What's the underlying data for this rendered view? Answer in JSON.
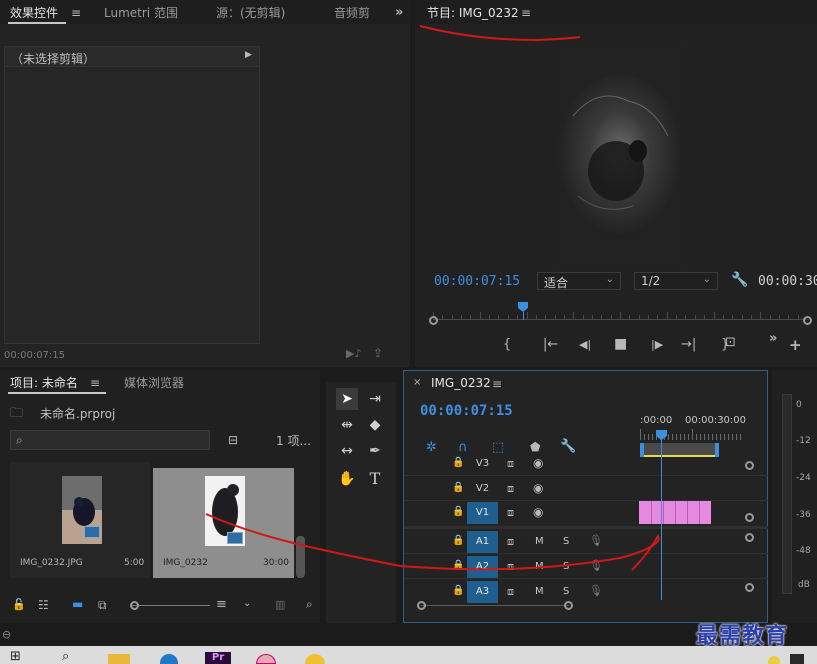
{
  "effect_controls": {
    "tabs": [
      "效果控件",
      "Lumetri 范围",
      "源：(无剪辑)",
      "音频剪"
    ],
    "no_clip": "（未选择剪辑）",
    "timecode": "00:00:07:15"
  },
  "program": {
    "tab_label": "节目: IMG_0232",
    "timecode": "00:00:07:15",
    "fit_option": "适合",
    "resolution": "1/2",
    "duration": "00:00:30",
    "playhead_fraction": 0.24
  },
  "project": {
    "tabs": [
      "项目: 未命名",
      "媒体浏览器"
    ],
    "project_file": "未命名.prproj",
    "item_count": "1 项...",
    "items": [
      {
        "name": "IMG_0232.JPG",
        "duration": "5:00"
      },
      {
        "name": "IMG_0232",
        "duration": "30:00"
      }
    ]
  },
  "timeline": {
    "tab_label": "IMG_0232",
    "timecode": "00:00:07:15",
    "ruler": [
      ":00:00",
      "00:00:30:00"
    ],
    "video_tracks": [
      "V3",
      "V2",
      "V1"
    ],
    "audio_tracks": [
      "A1",
      "A2",
      "A3"
    ],
    "mute_label": "M",
    "solo_label": "S"
  },
  "meters": {
    "scale": [
      "0",
      "-12",
      "-24",
      "-36",
      "-48",
      "dB"
    ]
  },
  "watermark": "最需教育",
  "colors": {
    "accent_blue": "#3d8fe0",
    "track_target": "#1f5f8f",
    "clip_pink": "#e58ae0",
    "annotation_red": "#d01818"
  },
  "taskbar": {
    "apps": [
      "start-icon",
      "search-icon",
      "file-explorer-icon",
      "edge-icon",
      "premiere-icon",
      "app-icon",
      "chrome-icon"
    ],
    "premiere_label": "Pr"
  }
}
